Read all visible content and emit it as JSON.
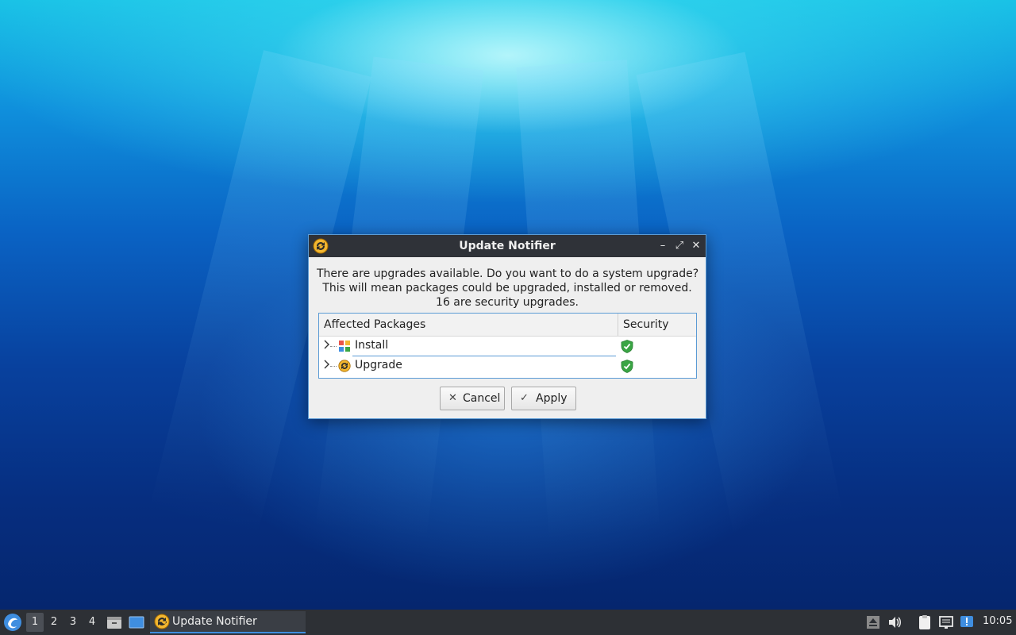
{
  "dialog": {
    "title": "Update Notifier",
    "message_lines": [
      "There are upgrades available. Do you want to do a system upgrade?",
      "This will mean packages could be upgraded, installed or removed.",
      "16 are security upgrades."
    ],
    "table": {
      "columns": [
        "Affected Packages",
        "Security"
      ],
      "rows": [
        {
          "label": "Install",
          "icon": "package-icon",
          "security": "shield-check-icon"
        },
        {
          "label": "Upgrade",
          "icon": "update-icon",
          "security": "shield-check-icon"
        }
      ]
    },
    "buttons": {
      "cancel": "Cancel",
      "apply": "Apply"
    },
    "window_controls": {
      "minimize": "–",
      "maximize": "⤢",
      "close": "✕"
    }
  },
  "taskbar": {
    "workspaces": [
      "1",
      "2",
      "3",
      "4"
    ],
    "active_workspace": "1",
    "active_task": "Update Notifier",
    "clock": "10:05"
  },
  "colors": {
    "accent": "#5b9bd5",
    "titlebar": "#2f3238",
    "taskbar": "#2d3035",
    "shield": "#3aa544",
    "update_icon": "#f2b630"
  }
}
